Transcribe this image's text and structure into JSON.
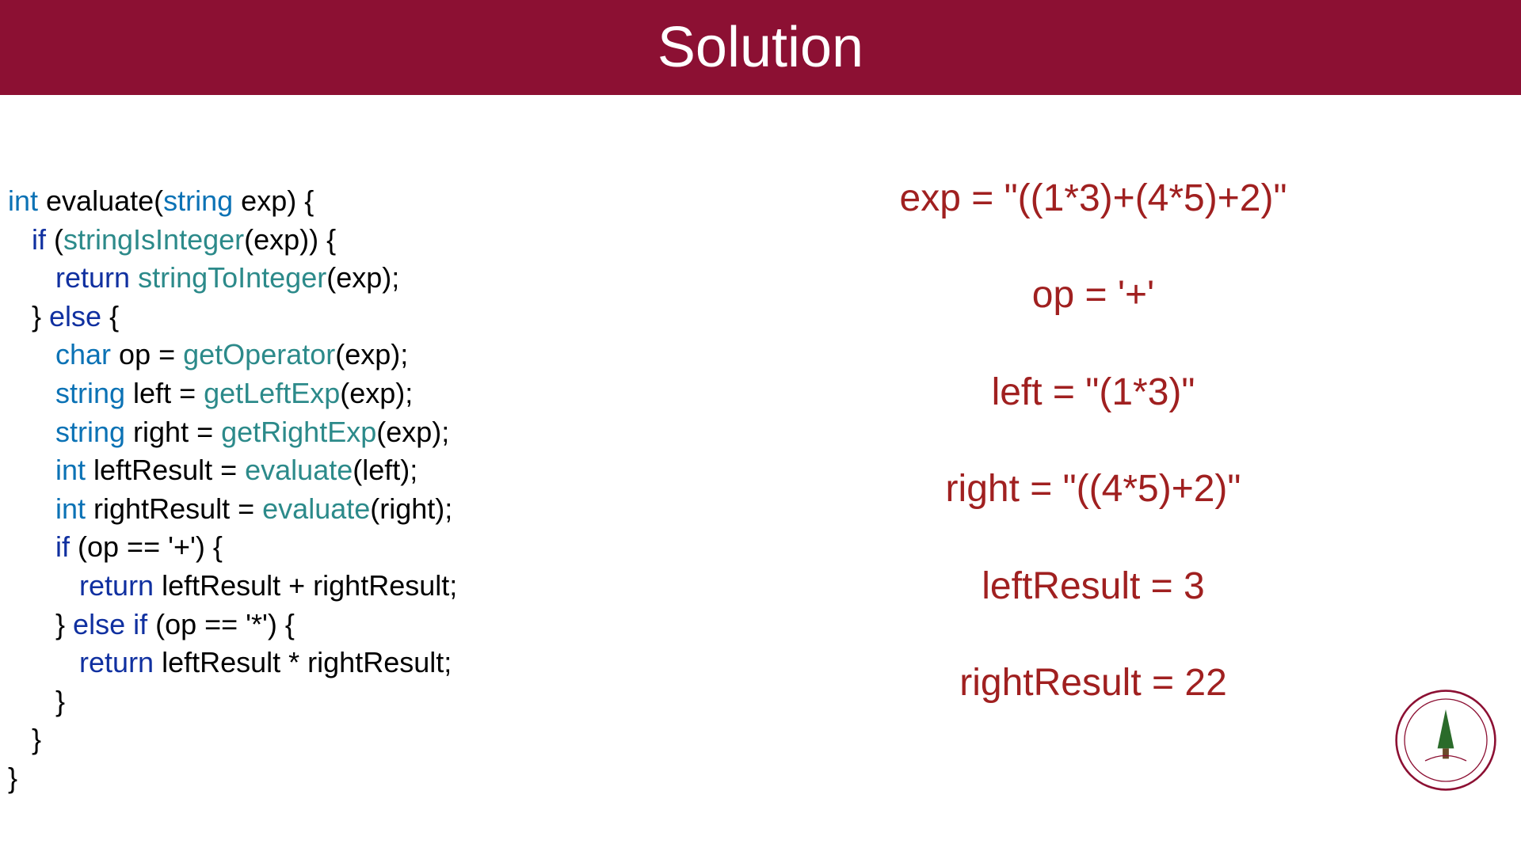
{
  "header": {
    "title": "Solution"
  },
  "code": {
    "l1_t1": "int",
    "l1_t2": " evaluate(",
    "l1_t3": "string",
    "l1_t4": " exp) {",
    "l2_t1": "   ",
    "l2_t2": "if",
    "l2_t3": " (",
    "l2_t4": "stringIsInteger",
    "l2_t5": "(exp)) {",
    "l3_t1": "      ",
    "l3_t2": "return",
    "l3_t3": " ",
    "l3_t4": "stringToInteger",
    "l3_t5": "(exp);",
    "l4_t1": "   } ",
    "l4_t2": "else",
    "l4_t3": " {",
    "l5_t1": "      ",
    "l5_t2": "char",
    "l5_t3": " op = ",
    "l5_t4": "getOperator",
    "l5_t5": "(exp);",
    "l6_t1": "      ",
    "l6_t2": "string",
    "l6_t3": " left = ",
    "l6_t4": "getLeftExp",
    "l6_t5": "(exp);",
    "l7_t1": "      ",
    "l7_t2": "string",
    "l7_t3": " right = ",
    "l7_t4": "getRightExp",
    "l7_t5": "(exp);",
    "l8_t1": "      ",
    "l8_t2": "int",
    "l8_t3": " leftResult = ",
    "l8_t4": "evaluate",
    "l8_t5": "(left);",
    "l9_t1": "      ",
    "l9_t2": "int",
    "l9_t3": " rightResult = ",
    "l9_t4": "evaluate",
    "l9_t5": "(right);",
    "l10_t1": "      ",
    "l10_t2": "if",
    "l10_t3": " (op == '+') {",
    "l11_t1": "         ",
    "l11_t2": "return",
    "l11_t3": " leftResult + rightResult;",
    "l12_t1": "      } ",
    "l12_t2": "else if",
    "l12_t3": " (op == '*') {",
    "l13_t1": "         ",
    "l13_t2": "return",
    "l13_t3": " leftResult * rightResult;",
    "l14": "      }",
    "l15": "   }",
    "l16": "}"
  },
  "trace": {
    "exp": "exp = \"((1*3)+(4*5)+2)\"",
    "op": "op = '+'",
    "left": "left = \"(1*3)\"",
    "right": "right = \"((4*5)+2)\"",
    "leftResult": "leftResult = 3",
    "rightResult": "rightResult = 22"
  },
  "colors": {
    "headerBg": "#8c1033",
    "trace": "#a02020"
  }
}
